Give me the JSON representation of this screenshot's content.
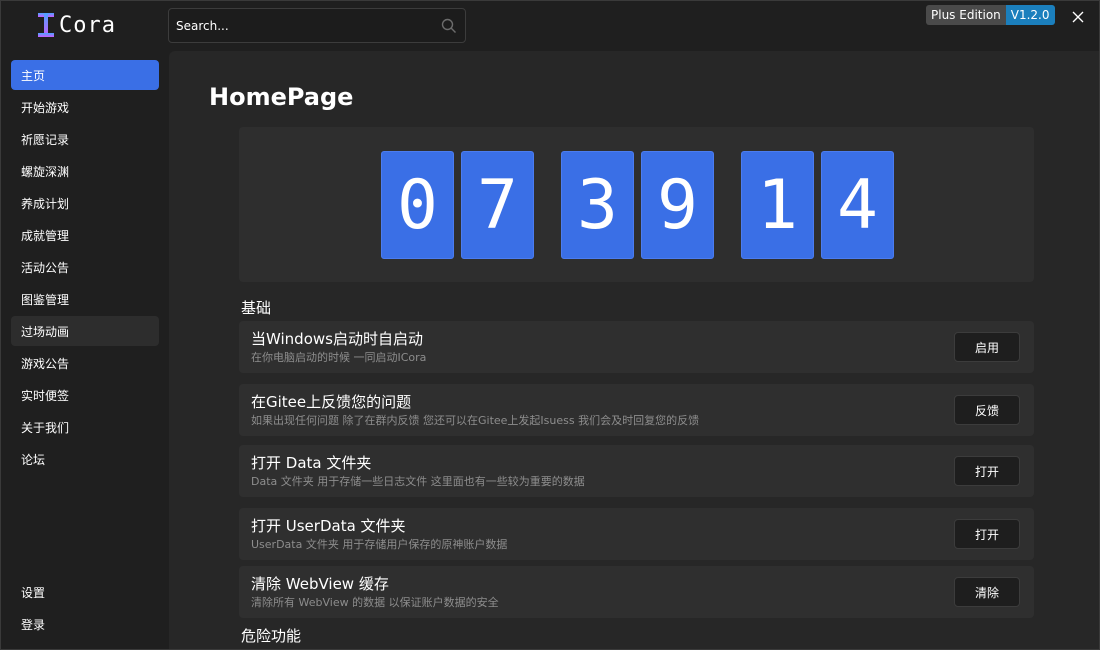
{
  "app": {
    "logo_text": "Cora"
  },
  "sidebar": {
    "items": [
      {
        "label": "主页"
      },
      {
        "label": "开始游戏"
      },
      {
        "label": "祈愿记录"
      },
      {
        "label": "螺旋深渊"
      },
      {
        "label": "养成计划"
      },
      {
        "label": "成就管理"
      },
      {
        "label": "活动公告"
      },
      {
        "label": "图鉴管理"
      },
      {
        "label": "过场动画"
      },
      {
        "label": "游戏公告"
      },
      {
        "label": "实时便签"
      },
      {
        "label": "关于我们"
      },
      {
        "label": "论坛"
      }
    ],
    "bottom": [
      {
        "label": "设置"
      },
      {
        "label": "登录"
      }
    ],
    "active_index": 0,
    "hover_index": 8
  },
  "search": {
    "placeholder": "Search..."
  },
  "edition_badge": {
    "edition": "Plus Edition",
    "version": "V1.2.0"
  },
  "main": {
    "title": "HomePage",
    "clock": {
      "digits": [
        "0",
        "7",
        "3",
        "9",
        "1",
        "4"
      ]
    },
    "section_basic": "基础",
    "cards": [
      {
        "title": "当Windows启动时自启动",
        "desc": "在你电脑启动的时候 一同启动ICora",
        "button": "启用"
      },
      {
        "title": "在Gitee上反馈您的问题",
        "desc": "如果出现任何问题 除了在群内反馈 您还可以在Gitee上发起Isuess 我们会及时回复您的反馈",
        "button": "反馈"
      },
      {
        "title": "打开 Data 文件夹",
        "desc": "Data 文件夹 用于存储一些日志文件 这里面也有一些较为重要的数据",
        "button": "打开"
      },
      {
        "title": "打开 UserData 文件夹",
        "desc": "UserData 文件夹 用于存储用户保存的原神账户数据",
        "button": "打开"
      },
      {
        "title": "清除 WebView 缓存",
        "desc": "清除所有 WebView 的数据 以保证账户数据的安全",
        "button": "清除"
      }
    ],
    "section_next": "危险功能"
  },
  "colors": {
    "accent": "#3a6fe6",
    "version_badge": "#1b7fbd",
    "background": "#1f1f1f",
    "panel": "#272727"
  }
}
